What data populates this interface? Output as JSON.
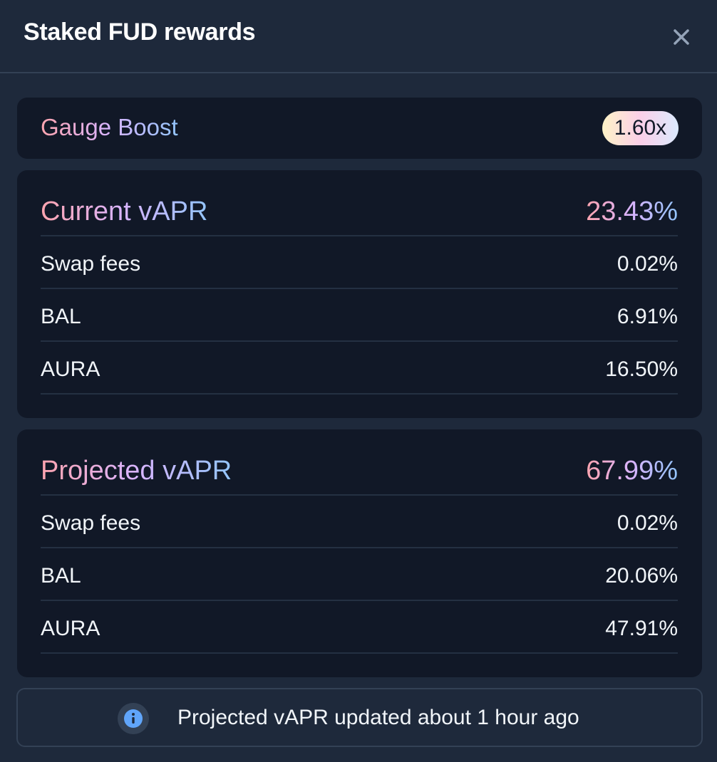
{
  "modal": {
    "title": "Staked FUD rewards",
    "close_icon": "close-icon"
  },
  "boost": {
    "label": "Gauge Boost",
    "value": "1.60x"
  },
  "current": {
    "title": "Current vAPR",
    "total": "23.43%",
    "rows": [
      {
        "label": "Swap fees",
        "value": "0.02%"
      },
      {
        "label": "BAL",
        "value": "6.91%"
      },
      {
        "label": "AURA",
        "value": "16.50%"
      }
    ]
  },
  "projected": {
    "title": "Projected vAPR",
    "total": "67.99%",
    "rows": [
      {
        "label": "Swap fees",
        "value": "0.02%"
      },
      {
        "label": "BAL",
        "value": "20.06%"
      },
      {
        "label": "AURA",
        "value": "47.91%"
      }
    ]
  },
  "info": {
    "icon": "info-icon",
    "text": "Projected vAPR updated about 1 hour ago"
  },
  "colors": {
    "background": "#1e293b",
    "card": "#111827",
    "gradient_start": "#fda4af",
    "gradient_mid": "#d8b4fe",
    "gradient_end": "#93c5fd",
    "info_icon": "#60a5fa"
  }
}
